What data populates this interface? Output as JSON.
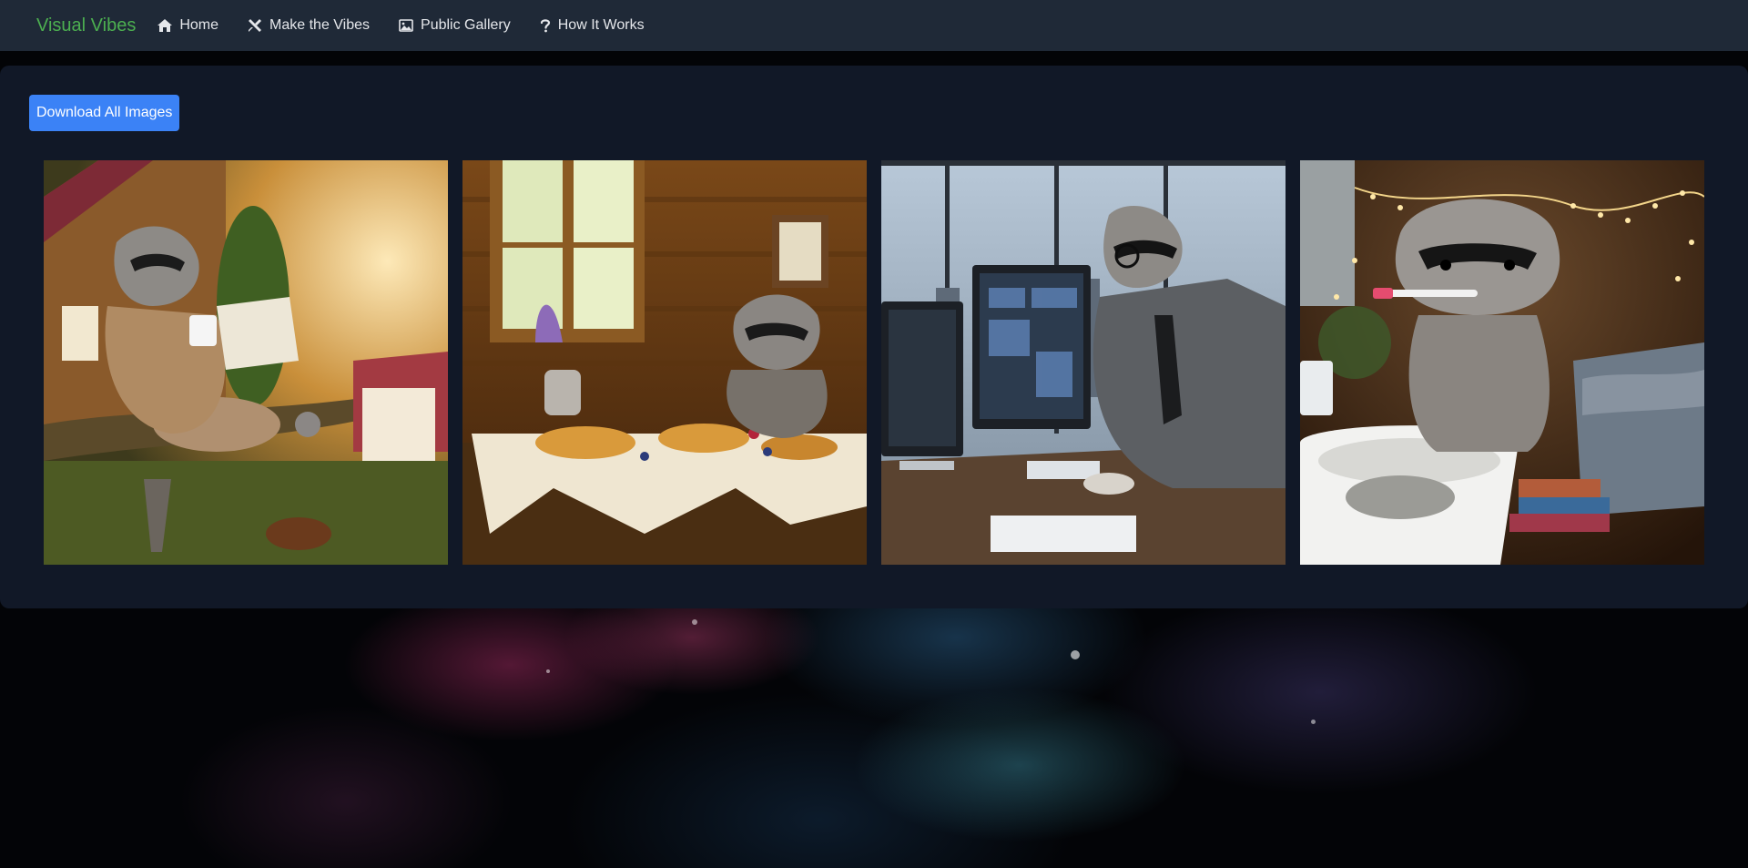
{
  "navbar": {
    "brand": "Visual Vibes",
    "brand_color": "#4caf50",
    "items": [
      {
        "label": "Home",
        "icon": "home-icon"
      },
      {
        "label": "Make the Vibes",
        "icon": "tools-icon"
      },
      {
        "label": "Public Gallery",
        "icon": "image-icon"
      },
      {
        "label": "How It Works",
        "icon": "question-icon"
      }
    ]
  },
  "toolbar": {
    "download_label": "Download All Images",
    "download_color": "#3b82f6"
  },
  "gallery": {
    "images": [
      {
        "icon": "raccoon-tree-coffee-image"
      },
      {
        "icon": "raccoon-breakfast-cabin-image"
      },
      {
        "icon": "raccoon-office-computer-image"
      },
      {
        "icon": "raccoon-bathroom-toothbrush-image"
      }
    ]
  }
}
